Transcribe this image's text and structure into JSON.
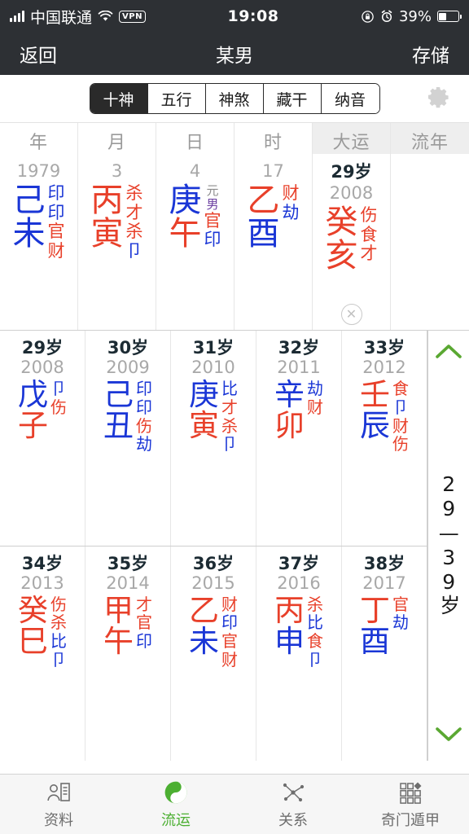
{
  "status_bar": {
    "carrier": "中国联通",
    "time": "19:08",
    "battery_percent": "39%",
    "vpn_label": "VPN",
    "icons": [
      "signal-bars-icon",
      "wifi-icon",
      "vpn-badge-icon",
      "rotation-lock-icon",
      "alarm-clock-icon",
      "battery-icon"
    ]
  },
  "navbar": {
    "back_label": "返回",
    "title": "某男",
    "save_label": "存储"
  },
  "segmented": {
    "items": [
      {
        "label": "十神",
        "active": true
      },
      {
        "label": "五行",
        "active": false
      },
      {
        "label": "神煞",
        "active": false
      },
      {
        "label": "藏干",
        "active": false
      },
      {
        "label": "纳音",
        "active": false
      }
    ],
    "gear_icon": "gear-icon"
  },
  "pillars": {
    "columns": [
      {
        "header": "年",
        "sub": "1979",
        "stems": [
          {
            "char": "己",
            "color": "blue"
          },
          {
            "char": "未",
            "color": "blue"
          }
        ],
        "gods_top": [
          {
            "char": "印",
            "color": "blue"
          }
        ],
        "gods_hidden": [
          {
            "char": "印",
            "color": "blue"
          },
          {
            "char": "官",
            "color": "red"
          },
          {
            "char": "财",
            "color": "red"
          }
        ]
      },
      {
        "header": "月",
        "sub": "3",
        "stems": [
          {
            "char": "丙",
            "color": "red"
          },
          {
            "char": "寅",
            "color": "red"
          }
        ],
        "gods_top": [
          {
            "char": "杀",
            "color": "red"
          }
        ],
        "gods_hidden": [
          {
            "char": "才",
            "color": "red"
          },
          {
            "char": "杀",
            "color": "red"
          },
          {
            "char": "卩",
            "color": "blue"
          }
        ]
      },
      {
        "header": "日",
        "sub": "4",
        "stems": [
          {
            "char": "庚",
            "color": "blue"
          },
          {
            "char": "午",
            "color": "red"
          }
        ],
        "gods_top": [
          {
            "char": "元",
            "color": "gray"
          },
          {
            "char": "男",
            "color": "purple"
          }
        ],
        "gods_hidden": [
          {
            "char": "官",
            "color": "red"
          },
          {
            "char": "印",
            "color": "blue"
          }
        ]
      },
      {
        "header": "时",
        "sub": "17",
        "stems": [
          {
            "char": "乙",
            "color": "red"
          },
          {
            "char": "酉",
            "color": "blue"
          }
        ],
        "gods_top": [
          {
            "char": "财",
            "color": "red"
          }
        ],
        "gods_hidden": [
          {
            "char": "劫",
            "color": "blue"
          }
        ]
      },
      {
        "header": "大运",
        "age": "29岁",
        "sub": "2008",
        "shaded": true,
        "stems": [
          {
            "char": "癸",
            "color": "red"
          },
          {
            "char": "亥",
            "color": "red"
          }
        ],
        "gods_top": [
          {
            "char": "伤",
            "color": "red"
          }
        ],
        "gods_hidden": [
          {
            "char": "食",
            "color": "red"
          },
          {
            "char": "才",
            "color": "red"
          }
        ],
        "close_icon": "close-circle-icon"
      },
      {
        "header": "流年",
        "sub": "",
        "shaded": true,
        "stems": [],
        "gods_top": [],
        "gods_hidden": []
      }
    ]
  },
  "years": {
    "rows": [
      [
        {
          "age": "29岁",
          "year": "2008",
          "stems": [
            {
              "char": "戊",
              "color": "blue"
            },
            {
              "char": "子",
              "color": "red"
            }
          ],
          "gods": [
            {
              "char": "卩",
              "color": "blue"
            },
            {
              "char": "伤",
              "color": "red"
            }
          ]
        },
        {
          "age": "30岁",
          "year": "2009",
          "stems": [
            {
              "char": "己",
              "color": "blue"
            },
            {
              "char": "丑",
              "color": "blue"
            }
          ],
          "gods": [
            {
              "char": "印",
              "color": "blue"
            },
            {
              "char": "印",
              "color": "blue"
            },
            {
              "char": "伤",
              "color": "red"
            },
            {
              "char": "劫",
              "color": "blue"
            }
          ]
        },
        {
          "age": "31岁",
          "year": "2010",
          "stems": [
            {
              "char": "庚",
              "color": "blue"
            },
            {
              "char": "寅",
              "color": "red"
            }
          ],
          "gods": [
            {
              "char": "比",
              "color": "blue"
            },
            {
              "char": "才",
              "color": "red"
            },
            {
              "char": "杀",
              "color": "red"
            },
            {
              "char": "卩",
              "color": "blue"
            }
          ]
        },
        {
          "age": "32岁",
          "year": "2011",
          "stems": [
            {
              "char": "辛",
              "color": "blue"
            },
            {
              "char": "卯",
              "color": "red"
            }
          ],
          "gods": [
            {
              "char": "劫",
              "color": "blue"
            },
            {
              "char": "财",
              "color": "red"
            }
          ]
        },
        {
          "age": "33岁",
          "year": "2012",
          "stems": [
            {
              "char": "壬",
              "color": "red"
            },
            {
              "char": "辰",
              "color": "blue"
            }
          ],
          "gods": [
            {
              "char": "食",
              "color": "red"
            },
            {
              "char": "卩",
              "color": "blue"
            },
            {
              "char": "财",
              "color": "red"
            },
            {
              "char": "伤",
              "color": "red"
            }
          ]
        }
      ],
      [
        {
          "age": "34岁",
          "year": "2013",
          "stems": [
            {
              "char": "癸",
              "color": "red"
            },
            {
              "char": "巳",
              "color": "red"
            }
          ],
          "gods": [
            {
              "char": "伤",
              "color": "red"
            },
            {
              "char": "杀",
              "color": "red"
            },
            {
              "char": "比",
              "color": "blue"
            },
            {
              "char": "卩",
              "color": "blue"
            }
          ]
        },
        {
          "age": "35岁",
          "year": "2014",
          "stems": [
            {
              "char": "甲",
              "color": "red"
            },
            {
              "char": "午",
              "color": "red"
            }
          ],
          "gods": [
            {
              "char": "才",
              "color": "red"
            },
            {
              "char": "官",
              "color": "red"
            },
            {
              "char": "印",
              "color": "blue"
            }
          ]
        },
        {
          "age": "36岁",
          "year": "2015",
          "stems": [
            {
              "char": "乙",
              "color": "red"
            },
            {
              "char": "未",
              "color": "blue"
            }
          ],
          "gods": [
            {
              "char": "财",
              "color": "red"
            },
            {
              "char": "印",
              "color": "blue"
            },
            {
              "char": "官",
              "color": "red"
            },
            {
              "char": "财",
              "color": "red"
            }
          ]
        },
        {
          "age": "37岁",
          "year": "2016",
          "stems": [
            {
              "char": "丙",
              "color": "red"
            },
            {
              "char": "申",
              "color": "blue"
            }
          ],
          "gods": [
            {
              "char": "杀",
              "color": "red"
            },
            {
              "char": "比",
              "color": "blue"
            },
            {
              "char": "食",
              "color": "red"
            },
            {
              "char": "卩",
              "color": "blue"
            }
          ]
        },
        {
          "age": "38岁",
          "year": "2017",
          "stems": [
            {
              "char": "丁",
              "color": "red"
            },
            {
              "char": "酉",
              "color": "blue"
            }
          ],
          "gods": [
            {
              "char": "官",
              "color": "red"
            },
            {
              "char": "劫",
              "color": "blue"
            }
          ]
        }
      ]
    ],
    "side": {
      "up_icon": "chevron-up-icon",
      "down_icon": "chevron-down-icon",
      "range_label": "29—39岁"
    }
  },
  "tabbar": {
    "items": [
      {
        "label": "资料",
        "icon": "profile-card-icon",
        "active": false
      },
      {
        "label": "流运",
        "icon": "yin-yang-icon",
        "active": true
      },
      {
        "label": "关系",
        "icon": "network-relations-icon",
        "active": false
      },
      {
        "label": "奇门遁甲",
        "icon": "grid-squares-icon",
        "active": false
      }
    ]
  },
  "colors": {
    "red": "#e8402a",
    "blue": "#1a36d6",
    "purple": "#6b3fa0",
    "accent_green": "#4caf32",
    "navbar_bg": "#2d3034"
  }
}
